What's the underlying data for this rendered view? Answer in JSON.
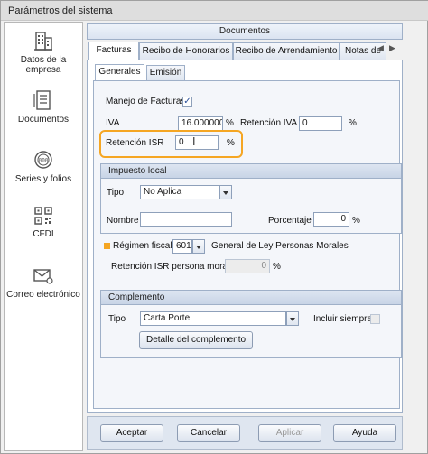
{
  "window": {
    "title": "Parámetros del sistema"
  },
  "sidebar": {
    "items": [
      {
        "label_line1": "Datos de la",
        "label_line2": "empresa",
        "icon": "building-icon"
      },
      {
        "label_line1": "Documentos",
        "label_line2": "",
        "icon": "document-icon"
      },
      {
        "label_line1": "Series y folios",
        "label_line2": "",
        "icon": "series-icon"
      },
      {
        "label_line1": "CFDI",
        "label_line2": "",
        "icon": "qr-code-icon"
      },
      {
        "label_line1": "Correo electrónico",
        "label_line2": "",
        "icon": "envelope-gear-icon"
      }
    ]
  },
  "main": {
    "header": "Documentos",
    "tabs": [
      "Facturas",
      "Recibo de Honorarios",
      "Recibo de Arrendamiento",
      "Notas de C"
    ],
    "subtabs": [
      "Generales",
      "Emisión"
    ]
  },
  "form": {
    "manejo_label": "Manejo de Facturas",
    "manejo_checked": "✓",
    "iva_label": "IVA",
    "iva_value": "16.000000",
    "pct": "%",
    "ret_iva_label": "Retención IVA",
    "ret_iva_value": "0",
    "ret_isr_label": "Retención ISR",
    "ret_isr_value": "0"
  },
  "impuesto_local": {
    "title": "Impuesto local",
    "tipo_label": "Tipo",
    "tipo_value": "No Aplica",
    "nombre_label": "Nombre",
    "nombre_value": "",
    "porcentaje_label": "Porcentaje",
    "porcentaje_value": "0"
  },
  "regimen": {
    "label": "Régimen fiscal",
    "code": "601",
    "description": "General de Ley Personas Morales",
    "ret_moral_label": "Retención ISR persona moral",
    "ret_moral_value": "0"
  },
  "complemento": {
    "title": "Complemento",
    "tipo_label": "Tipo",
    "tipo_value": "Carta Porte",
    "incluir_label": "Incluir siempre",
    "detalle_button": "Detalle del complemento"
  },
  "buttons": {
    "aceptar": "Aceptar",
    "cancelar": "Cancelar",
    "aplicar": "Aplicar",
    "ayuda": "Ayuda"
  },
  "colors": {
    "highlight": "#f5a623",
    "required_marker": "#f5a623",
    "tab_border": "#9fb0c8"
  }
}
